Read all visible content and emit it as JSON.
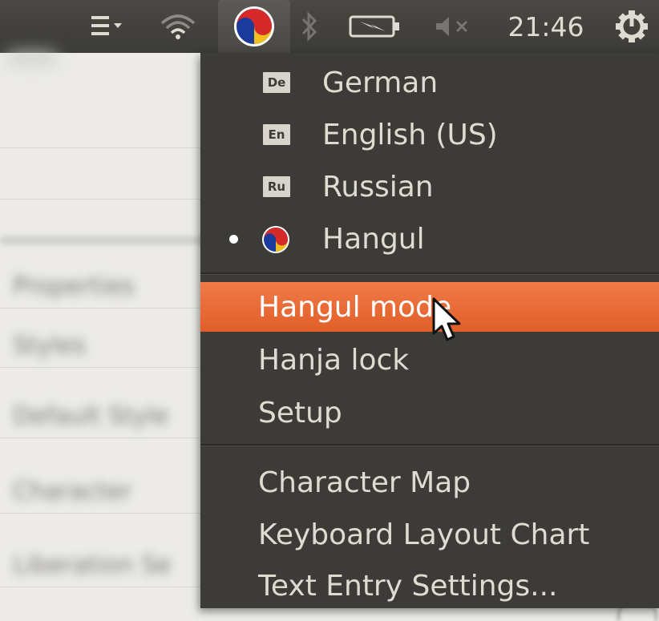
{
  "panel": {
    "clock": "21:46",
    "icons": [
      "messaging-menu-icon",
      "wifi-icon",
      "input-method-icon",
      "bluetooth-icon",
      "battery-icon",
      "volume-muted-icon",
      "power-gear-icon"
    ]
  },
  "menu": {
    "languages": [
      {
        "badge": "De",
        "label": "German"
      },
      {
        "badge": "En",
        "label": "English (US)"
      },
      {
        "badge": "Ru",
        "label": "Russian"
      },
      {
        "badge": "",
        "label": "Hangul",
        "selected": true
      }
    ],
    "modes": [
      {
        "label": "Hangul mode",
        "highlighted": true
      },
      {
        "label": "Hanja lock"
      },
      {
        "label": "Setup"
      }
    ],
    "tools": [
      {
        "label": "Character Map"
      },
      {
        "label": "Keyboard Layout Chart"
      },
      {
        "label": "Text Entry Settings..."
      }
    ]
  },
  "colors": {
    "panel": "#3c3b37",
    "menu_bg": "#3c3b37",
    "highlight": "#e8672f",
    "text": "#dfdbd2"
  },
  "background_window": {
    "rows": [
      "Properties",
      "Styles",
      "Default Style",
      "Character",
      "Liberation Se"
    ]
  }
}
